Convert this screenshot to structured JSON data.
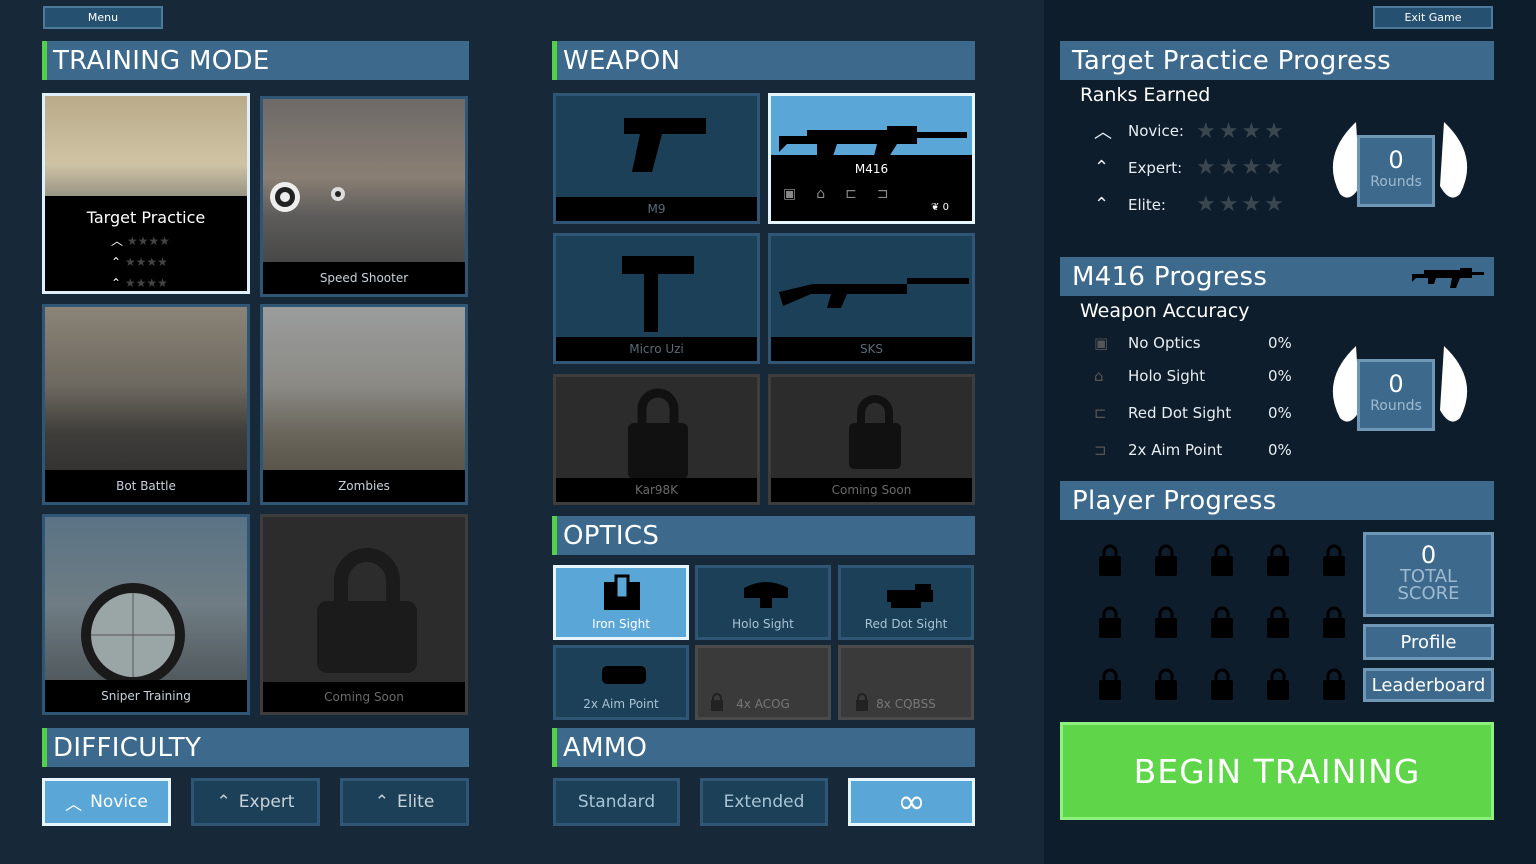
{
  "top": {
    "menu_label": "Menu",
    "exit_label": "Exit Game"
  },
  "training_mode": {
    "header": "TRAINING MODE",
    "modes": [
      {
        "label": "Target Practice"
      },
      {
        "label": "Speed Shooter"
      },
      {
        "label": "Bot Battle"
      },
      {
        "label": "Zombies"
      },
      {
        "label": "Sniper Training"
      },
      {
        "label": "Coming Soon"
      }
    ]
  },
  "weapon": {
    "header": "WEAPON",
    "weapons": [
      {
        "label": "M9"
      },
      {
        "label": "M416",
        "count": "0"
      },
      {
        "label": "Micro Uzi"
      },
      {
        "label": "SKS"
      },
      {
        "label": "Kar98K"
      },
      {
        "label": "Coming Soon"
      }
    ]
  },
  "optics": {
    "header": "OPTICS",
    "items": [
      {
        "label": "Iron Sight"
      },
      {
        "label": "Holo Sight"
      },
      {
        "label": "Red Dot Sight"
      },
      {
        "label": "2x Aim Point"
      },
      {
        "label": "4x ACOG"
      },
      {
        "label": "8x CQBSS"
      }
    ]
  },
  "difficulty": {
    "header": "DIFFICULTY",
    "options": [
      {
        "label": "Novice"
      },
      {
        "label": "Expert"
      },
      {
        "label": "Elite"
      }
    ]
  },
  "ammo": {
    "header": "AMMO",
    "options": [
      {
        "label": "Standard"
      },
      {
        "label": "Extended"
      },
      {
        "label": "∞"
      }
    ]
  },
  "target_progress": {
    "header": "Target Practice Progress",
    "subheader": "Ranks Earned",
    "ranks": [
      {
        "label": "Novice:"
      },
      {
        "label": "Expert:"
      },
      {
        "label": "Elite:"
      }
    ],
    "star_glyphs": "★★★★",
    "rounds_value": "0",
    "rounds_label": "Rounds"
  },
  "weapon_progress": {
    "header": "M416 Progress",
    "subheader": "Weapon Accuracy",
    "rows": [
      {
        "label": "No Optics",
        "value": "0%"
      },
      {
        "label": "Holo Sight",
        "value": "0%"
      },
      {
        "label": "Red Dot Sight",
        "value": "0%"
      },
      {
        "label": "2x Aim Point",
        "value": "0%"
      }
    ],
    "rounds_value": "0",
    "rounds_label": "Rounds"
  },
  "player_progress": {
    "header": "Player Progress",
    "total_value": "0",
    "total_label_1": "TOTAL",
    "total_label_2": "SCORE",
    "profile_label": "Profile",
    "leaderboard_label": "Leaderboard"
  },
  "begin_label": "BEGIN TRAINING",
  "colors": {
    "accent_green": "#5fd64a",
    "panel_blue": "#3d6a8c",
    "selected_blue": "#5aa6d6"
  }
}
